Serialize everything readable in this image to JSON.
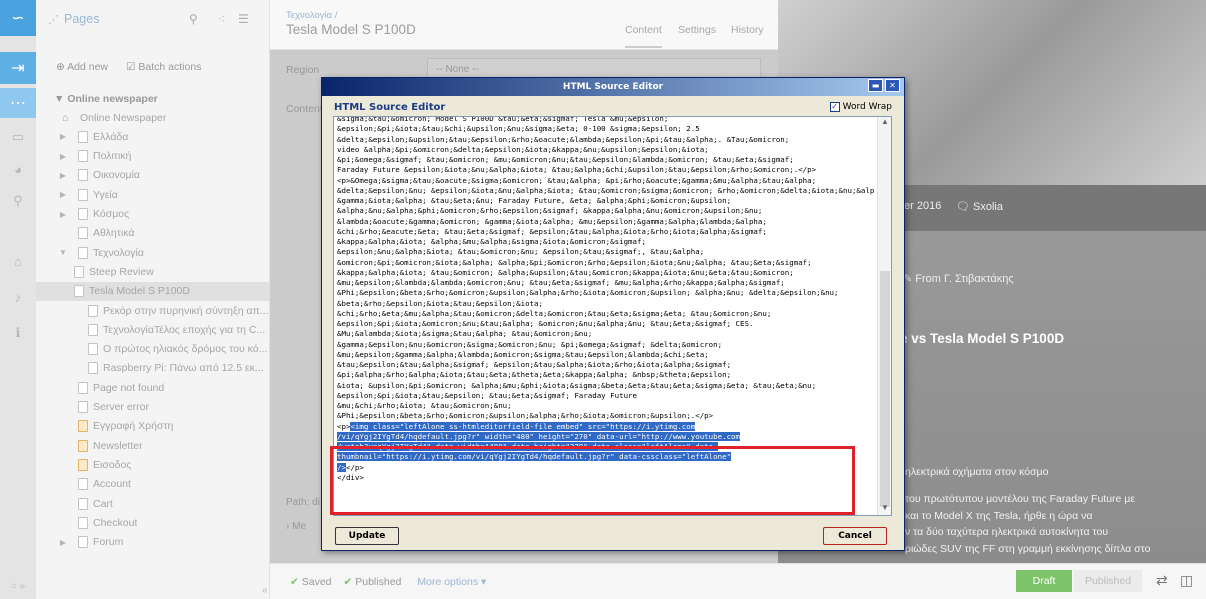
{
  "colors": {
    "accent": "#4aa3df",
    "rail": "#e4e4e4",
    "highlight": "#3169c6",
    "red_box": "#e0202a",
    "draft": "#7dc36a"
  },
  "tree": {
    "title": "Pages",
    "add_new": "Add new",
    "batch_actions": "Batch actions",
    "root": "Online newspaper",
    "items": [
      {
        "label": "Online Newspaper",
        "kind": "home",
        "indent": 1
      },
      {
        "label": "Ελλάδα",
        "kind": "page",
        "indent": 1,
        "arrow": "▶"
      },
      {
        "label": "Πολιτική",
        "kind": "page",
        "indent": 1,
        "arrow": "▶"
      },
      {
        "label": "Οικονομία",
        "kind": "page",
        "indent": 1,
        "arrow": "▶"
      },
      {
        "label": "Υγεία",
        "kind": "page",
        "indent": 1,
        "arrow": "▶"
      },
      {
        "label": "Κόσμος",
        "kind": "page",
        "indent": 1,
        "arrow": "▶"
      },
      {
        "label": "Αθλητικά",
        "kind": "page",
        "indent": 1,
        "arrow": ""
      },
      {
        "label": "Τεχνολογία",
        "kind": "page",
        "indent": 1,
        "arrow": "▼"
      },
      {
        "label": "Steep Review",
        "kind": "page",
        "indent": 2
      },
      {
        "label": "Tesla Model S P100D",
        "kind": "page",
        "indent": 2,
        "selected": true
      },
      {
        "label": "Ρεκόρ στην πυρηνική σύντηξη απ...",
        "kind": "page",
        "indent": 3
      },
      {
        "label": "ΤεχνολογίαΤέλος εποχής για τη C...",
        "kind": "page",
        "indent": 3
      },
      {
        "label": "Ο πρώτος ηλιακός δρόμος του κό...",
        "kind": "page",
        "indent": 3
      },
      {
        "label": "Raspberry Pi: Πάνω από 12.5 εκ...",
        "kind": "page",
        "indent": 3
      },
      {
        "label": "Page not found",
        "kind": "page",
        "indent": 1
      },
      {
        "label": "Server error",
        "kind": "page",
        "indent": 1
      },
      {
        "label": "Εγγραφή Χρήστη",
        "kind": "special",
        "indent": 1
      },
      {
        "label": "Newsletter",
        "kind": "special",
        "indent": 1
      },
      {
        "label": "Εισοδος",
        "kind": "special",
        "indent": 1
      },
      {
        "label": "Account",
        "kind": "page",
        "indent": 1
      },
      {
        "label": "Cart",
        "kind": "page",
        "indent": 1
      },
      {
        "label": "Checkout",
        "kind": "page",
        "indent": 1
      },
      {
        "label": "Forum",
        "kind": "page",
        "indent": 1,
        "arrow": "▶"
      }
    ]
  },
  "editor": {
    "breadcrumb": "Τεχνολογία /",
    "title": "Tesla Model S P100D",
    "tabs": [
      "Content",
      "Settings",
      "History"
    ],
    "region_label": "Region",
    "region_value": "-- None --",
    "content_label": "Content",
    "path_label": "Path: di",
    "more_label": "› Me",
    "saved": "Saved",
    "published": "Published",
    "more_options": "More options"
  },
  "preview": {
    "date": "er 2016",
    "comments": "Sxolia",
    "author": "From Γ. Στιβακτάκης",
    "headline": "e vs Tesla Model S P100D",
    "subtitle": "ηλεκτρικά οχήματα στον κόσμο",
    "body_lines": [
      "του πρωτότυπου μοντέλου της Faraday Future με",
      "και το Model X της Tesla, ήρθε η ώρα να",
      "ν τα δύο ταχύτερα ηλεκτρικά αυτοκίνητα του",
      "ριώδες SUV της FF στη γραμμή εκκίνησης δίπλα στο"
    ],
    "draft": "Draft",
    "published": "Published"
  },
  "dialog": {
    "window_title": "HTML Source Editor",
    "heading": "HTML Source Editor",
    "word_wrap": "Word Wrap",
    "update": "Update",
    "cancel": "Cancel",
    "code_lines": [
      "&sigma;&tau;&omicron; Model S P100D &tau;&eta;&sigmaf; Tesla &mu;&epsilon;",
      "&epsilon;&pi;&iota;&tau;&chi;&upsilon;&nu;&sigma;&eta; 0-100 &sigma;&epsilon; 2.5",
      "&delta;&epsilon;&upsilon;&tau;&epsilon;&rho;&oacute;&lambda;&epsilon;&pi;&tau;&alpha;. &Tau;&omicron;",
      "video &alpha;&pi;&omicron;&delta;&epsilon;&iota;&kappa;&nu;&upsilon;&epsilon;&iota;",
      "&pi;&omega;&sigmaf; &tau;&omicron; &mu;&omicron;&nu;&tau;&epsilon;&lambda;&omicron; &tau;&eta;&sigmaf;",
      "Faraday Future &epsilon;&iota;&nu;&alpha;&iota; &tau;&alpha;&chi;&upsilon;&tau;&epsilon;&rho;&omicron;.</p>",
      "<p>&Omega;&sigma;&tau;&oacute;&sigma;&omicron; &tau;&alpha; &pi;&rho;&oacute;&gamma;&mu;&alpha;&tau;&alpha;",
      "&delta;&epsilon;&nu; &epsilon;&iota;&nu;&alpha;&iota; &tau;&omicron;&sigma;&omicron; &rho;&omicron;&delta;&iota;&nu;&alpha;",
      "&gamma;&iota;&alpha; &tau;&eta;&nu; Faraday Future, &eta; &alpha;&phi;&omicron;&upsilon;",
      "&alpha;&nu;&alpha;&phi;&omicron;&rho;&epsilon;&sigmaf; &kappa;&alpha;&nu;&omicron;&upsilon;&nu;",
      "&lambda;&oacute;&gamma;&omicron; &gamma;&iota;&alpha; &mu;&epsilon;&gamma;&alpha;&lambda;&alpha;",
      "&chi;&rho;&eacute;&eta; &tau;&eta;&sigmaf; &epsilon;&tau;&alpha;&iota;&rho;&iota;&alpha;&sigmaf;",
      "&kappa;&alpha;&iota; &alpha;&mu;&alpha;&sigma;&iota;&omicron;&sigmaf;",
      "&epsilon;&nu;&alpha;&iota; &tau;&omicron;&nu; &epsilon;&tau;&sigmaf;, &tau;&alpha;",
      "&omicron;&pi;&omicron;&iota;&alpha; &alpha;&pi;&omicron;&rho;&epsilon;&iota;&nu;&alpha; &tau;&eta;&sigmaf;",
      "&kappa;&alpha;&iota; &tau;&omicron; &alpha;&upsilon;&tau;&omicron;&kappa;&iota;&nu;&eta;&tau;&omicron;",
      "&mu;&epsilon;&lambda;&lambda;&omicron;&nu; &tau;&eta;&sigmaf; &mu;&alpha;&rho;&kappa;&alpha;&sigmaf;",
      "&Phi;&epsilon;&beta;&rho;&omicron;&upsilon;&alpha;&rho;&iota;&omicron;&upsilon; &alpha;&nu; &delta;&epsilon;&nu;",
      "&beta;&rho;&epsilon;&iota;&tau;&epsilon;&iota;",
      "&chi;&rho;&eta;&mu;&alpha;&tau;&omicron;&delta;&omicron;&tau;&eta;&sigma;&eta; &tau;&omicron;&nu;",
      "&epsilon;&pi;&iota;&omicron;&nu;&tau;&alpha; &omicron;&nu;&alpha;&nu; &tau;&eta;&sigmaf; CES.",
      "&Mu;&alambda;&iota;&sigma;&tau;&alpha; &tau;&omicron;&nu;",
      "&gamma;&epsilon;&nu;&omicron;&sigma;&omicron;&nu; &pi;&omega;&sigmaf; &delta;&omicron;",
      "&mu;&epsilon;&gamma;&alpha;&lambda;&omicron;&sigma;&tau;&epsilon;&lambda;&chi;&eta;",
      "&tau;&epsilon;&tau;&alpha;&sigmaf; &epsilon;&tau;&alpha;&iota;&rho;&iota;&alpha;&sigmaf;",
      "&pi;&alpha;&rho;&alpha;&iota;&tau;&eta;&theta;&eta;&kappa;&alpha; &nbsp;&theta;&epsilon;",
      "&iota; &upsilon;&pi;&omicron; &alpha;&mu;&phi;&iota;&sigma;&beta;&eta;&tau;&eta;&sigma;&eta; &tau;&eta;&nu;",
      "&epsilon;&pi;&iota;&tau;&epsilon; &tau;&eta;&sigmaf; Faraday Future",
      "&mu;&chi;&rho;&iota; &tau;&omicron;&nu;",
      "&Phi;&epsilon;&beta;&rho;&omicron;&upsilon;&alpha;&rho;&iota;&omicron;&upsilon;.</p>"
    ],
    "selected_lines": [
      "<img class=\"leftAlone ss-htmleditorfield-file embed\" src=\"https://i.ytimg.com",
      "/vi/qYgj2IYgTd4/hqdefault.jpg?r\" width=\"480\" height=\"270\" data-url=\"http://www.youtube.com",
      "/watch?v=qYgj2IYgTd4\" data-width=\"480\" data-height=\"270\" data-class=\"leftAlone\" data-",
      "thumbnail=\"https://i.ytimg.com/vi/qYgj2IYgTd4/hqdefault.jpg?r\" data-cssclass=\"leftAlone\""
    ],
    "p_open": "<p>",
    "sel_tail": "/>",
    "p_close": "</p>",
    "div_close": "</div>"
  }
}
